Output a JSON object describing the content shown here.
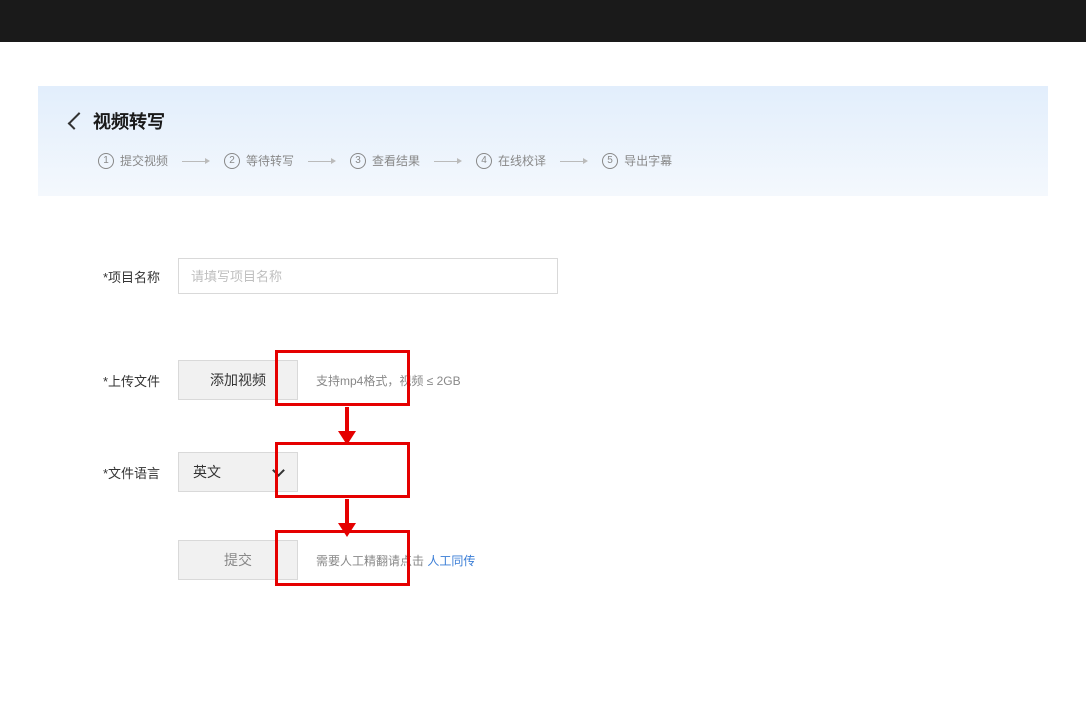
{
  "header": {
    "title": "视频转写",
    "steps": [
      {
        "num": "1",
        "label": "提交视频"
      },
      {
        "num": "2",
        "label": "等待转写"
      },
      {
        "num": "3",
        "label": "查看结果"
      },
      {
        "num": "4",
        "label": "在线校译"
      },
      {
        "num": "5",
        "label": "导出字幕"
      }
    ]
  },
  "form": {
    "project_name": {
      "label": "*项目名称",
      "placeholder": "请填写项目名称"
    },
    "upload": {
      "label": "*上传文件",
      "button": "添加视频",
      "hint": "支持mp4格式，视频 ≤ 2GB"
    },
    "language": {
      "label": "*文件语言",
      "value": "英文"
    },
    "submit": {
      "button": "提交",
      "hint_prefix": "需要人工精翻请点击",
      "hint_link": "人工同传"
    }
  }
}
